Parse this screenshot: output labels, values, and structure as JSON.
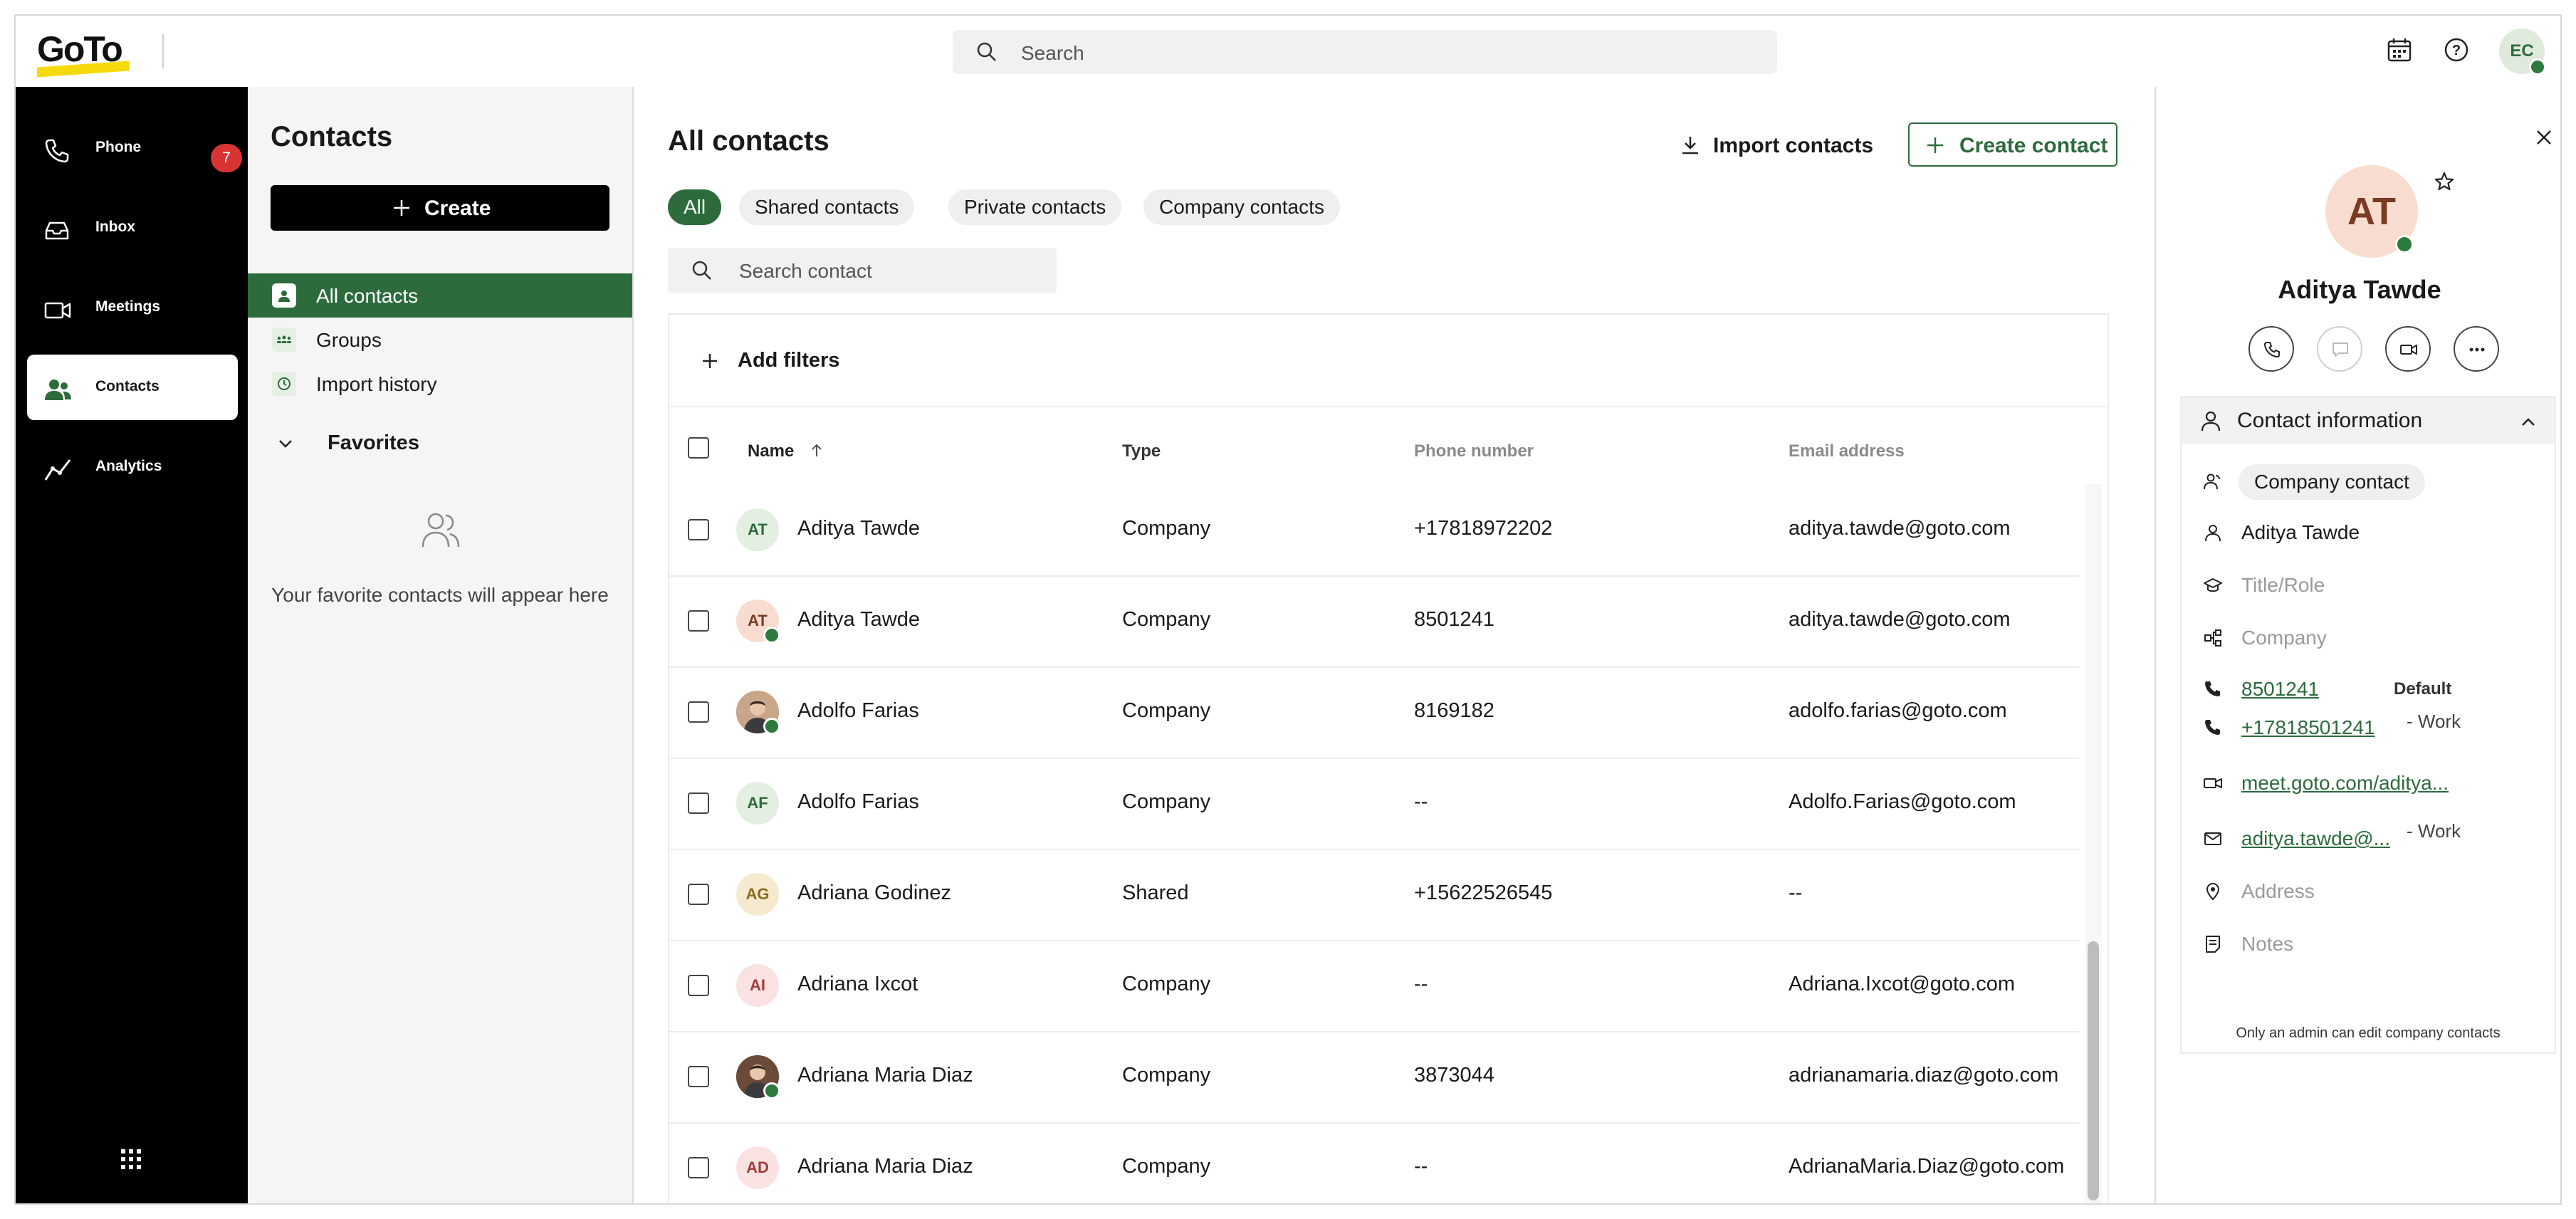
{
  "app": {
    "logo": "GoTo"
  },
  "header": {
    "search_placeholder": "Search",
    "user_initials": "EC"
  },
  "nav": {
    "items": [
      {
        "label": "Phone",
        "icon": "phone-icon",
        "badge": "7"
      },
      {
        "label": "Inbox",
        "icon": "inbox-icon"
      },
      {
        "label": "Meetings",
        "icon": "video-icon"
      },
      {
        "label": "Contacts",
        "icon": "contacts-icon",
        "active": true
      },
      {
        "label": "Analytics",
        "icon": "analytics-icon"
      }
    ]
  },
  "sidebar": {
    "title": "Contacts",
    "create_label": "Create",
    "items": [
      {
        "label": "All contacts",
        "active": true
      },
      {
        "label": "Groups"
      },
      {
        "label": "Import history"
      }
    ],
    "favorites_label": "Favorites",
    "favorites_empty": "Your favorite contacts will appear here"
  },
  "main": {
    "title": "All contacts",
    "import_label": "Import contacts",
    "create_contact_label": "Create contact",
    "tabs": [
      "All",
      "Shared contacts",
      "Private contacts",
      "Company contacts"
    ],
    "search_placeholder": "Search contact",
    "add_filters_label": "Add filters",
    "columns": [
      "Name",
      "Type",
      "Phone number",
      "Email address"
    ],
    "rows": [
      {
        "initials": "AT",
        "name": "Aditya Tawde",
        "type": "Company",
        "phone": "+17818972202",
        "email": "aditya.tawde@goto.com",
        "avatar_bg": "#e3efe0",
        "avatar_fg": "#2d6b3d",
        "online": false,
        "photo": false
      },
      {
        "initials": "AT",
        "name": "Aditya Tawde",
        "type": "Company",
        "phone": "8501241",
        "email": "aditya.tawde@goto.com",
        "avatar_bg": "#f8dccf",
        "avatar_fg": "#7a3b24",
        "online": true,
        "photo": false
      },
      {
        "initials": "",
        "name": "Adolfo Farias",
        "type": "Company",
        "phone": "8169182",
        "email": "adolfo.farias@goto.com",
        "avatar_bg": "#c9a58a",
        "avatar_fg": "#ffffff",
        "online": true,
        "photo": true
      },
      {
        "initials": "AF",
        "name": "Adolfo Farias",
        "type": "Company",
        "phone": "--",
        "email": "Adolfo.Farias@goto.com",
        "avatar_bg": "#e3efe0",
        "avatar_fg": "#2d6b3d",
        "online": false,
        "photo": false
      },
      {
        "initials": "AG",
        "name": "Adriana Godinez",
        "type": "Shared",
        "phone": "+15622526545",
        "email": "--",
        "avatar_bg": "#f5ead0",
        "avatar_fg": "#8a6a1f",
        "online": false,
        "photo": false
      },
      {
        "initials": "AI",
        "name": "Adriana Ixcot",
        "type": "Company",
        "phone": "--",
        "email": "Adriana.Ixcot@goto.com",
        "avatar_bg": "#fbe2e2",
        "avatar_fg": "#a33a3a",
        "online": false,
        "photo": false
      },
      {
        "initials": "",
        "name": "Adriana Maria Diaz",
        "type": "Company",
        "phone": "3873044",
        "email": "adrianamaria.diaz@goto.com",
        "avatar_bg": "#6b4a3a",
        "avatar_fg": "#ffffff",
        "online": true,
        "photo": true
      },
      {
        "initials": "AD",
        "name": "Adriana Maria Diaz",
        "type": "Company",
        "phone": "--",
        "email": "AdrianaMaria.Diaz@goto.com",
        "avatar_bg": "#fbe2e2",
        "avatar_fg": "#a33a3a",
        "online": false,
        "photo": false
      }
    ]
  },
  "detail": {
    "initials": "AT",
    "name": "Aditya Tawde",
    "section_title": "Contact information",
    "contact_type": "Company contact",
    "full_name": "Aditya Tawde",
    "title_placeholder": "Title/Role",
    "company_placeholder": "Company",
    "phone1": "8501241",
    "phone1_tag": "Default",
    "phone2": "+17818501241",
    "phone2_tag": "- Work",
    "meeting": "meet.goto.com/aditya...",
    "email": "aditya.tawde@...",
    "email_tag": "- Work",
    "address_placeholder": "Address",
    "notes_placeholder": "Notes",
    "admin_note": "Only an admin can edit company contacts"
  },
  "colors": {
    "brand_green": "#2d6b3d",
    "badge_red": "#d83434",
    "logo_yellow": "#f5d90a"
  }
}
